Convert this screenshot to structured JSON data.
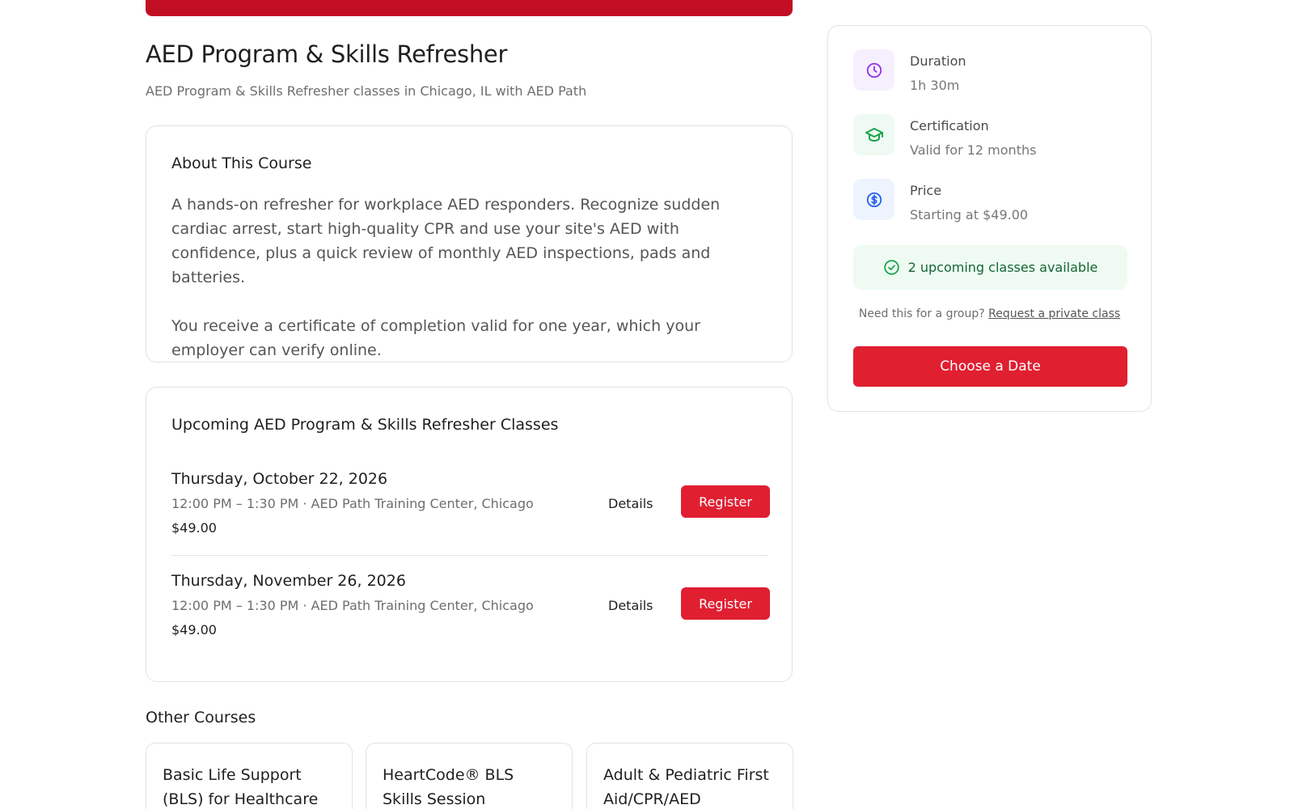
{
  "course": {
    "title": "AED Program & Skills Refresher",
    "subtitle": "AED Program & Skills Refresher classes in Chicago, IL with AED Path"
  },
  "about": {
    "heading": "About This Course",
    "paragraphs": [
      "A hands-on refresher for workplace AED responders. Recognize sudden cardiac arrest, start high-quality CPR and use your site's AED with confidence, plus a quick review of monthly AED inspections, pads and batteries.",
      "You receive a certificate of completion valid for one year, which your employer can verify online."
    ]
  },
  "classes": {
    "heading": "Upcoming AED Program & Skills Refresher Classes",
    "details_label": "Details",
    "register_label": "Register",
    "items": [
      {
        "date": "Thursday, October 22, 2026",
        "meta": "12:00 PM – 1:30 PM · AED Path Training Center, Chicago",
        "price": "$49.00"
      },
      {
        "date": "Thursday, November 26, 2026",
        "meta": "12:00 PM – 1:30 PM · AED Path Training Center, Chicago",
        "price": "$49.00"
      }
    ]
  },
  "other_courses": {
    "heading": "Other Courses",
    "items": [
      {
        "title": "Basic Life Support (BLS) for Healthcare"
      },
      {
        "title": "HeartCode® BLS Skills Session"
      },
      {
        "title": "Adult & Pediatric First Aid/CPR/AED"
      }
    ]
  },
  "sidebar": {
    "info": [
      {
        "label": "Duration",
        "value": "1h 30m",
        "icon": "clock-icon",
        "color": "#9333ea",
        "bg": "#f6f0fe"
      },
      {
        "label": "Certification",
        "value": "Valid for 12 months",
        "icon": "graduation-cap-icon",
        "color": "#16a34a",
        "bg": "#effaf3"
      },
      {
        "label": "Price",
        "value": "Starting at $49.00",
        "icon": "dollar-icon",
        "color": "#2563eb",
        "bg": "#eef4fe"
      }
    ],
    "availability": "2 upcoming classes available",
    "group_prompt": "Need this for a group?",
    "group_link": "Request a private class",
    "cta": "Choose a Date"
  },
  "colors": {
    "brand_red": "#e01f31",
    "hero_red": "#c30f23",
    "success_green": "#166534"
  }
}
